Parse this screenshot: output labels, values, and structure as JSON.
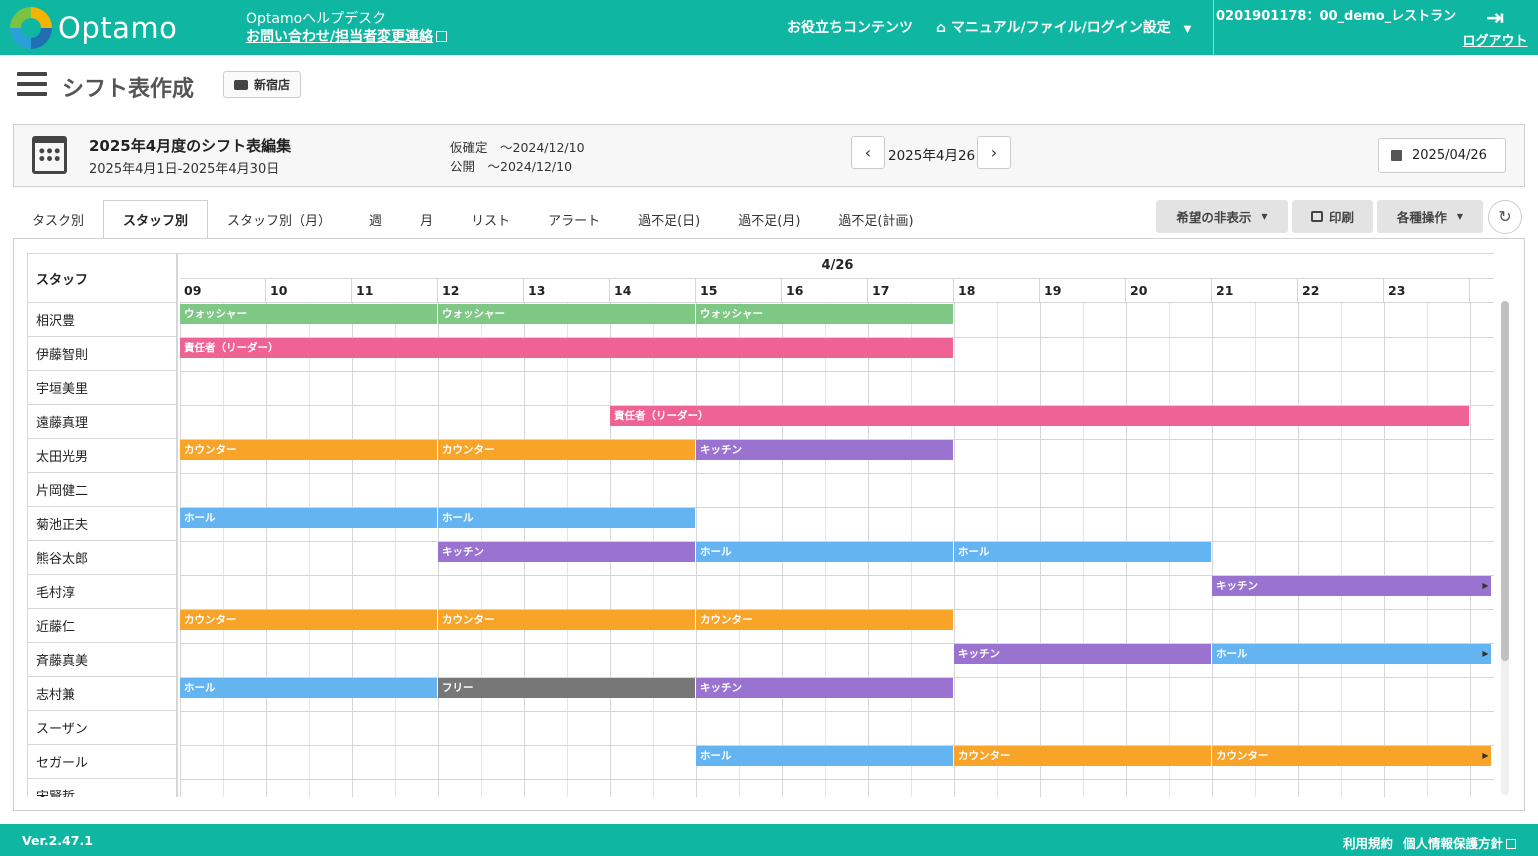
{
  "header": {
    "logo_text": "Optamo",
    "help_title": "Optamoヘルプデスク",
    "help_link": "お問い合わせ/担当者変更連絡",
    "useful": "お役立ちコンテンツ",
    "manual": "マニュアル/ファイル/ログイン設定",
    "account": "0201901178：00_demo_レストラン",
    "logout": "ログアウト"
  },
  "page": {
    "title": "シフト表作成",
    "store_button": "新宿店"
  },
  "info": {
    "title": "2025年4月度のシフト表編集",
    "range": "2025年4月1日-2025年4月30日",
    "tentative": "仮確定　～2024/12/10",
    "published": "公開　～2024/12/10",
    "current_date": "2025年4月26日",
    "date_input": "2025/04/26"
  },
  "tabs": [
    "タスク別",
    "スタッフ別",
    "スタッフ別（月）",
    "週",
    "月",
    "リスト",
    "アラート",
    "過不足(日)",
    "過不足(月)",
    "過不足(計画)"
  ],
  "active_tab": 1,
  "toolbar": {
    "hide_wishes": "希望の非表示",
    "print": "印刷",
    "operations": "各種操作"
  },
  "grid": {
    "staff_header": "スタッフ",
    "date_header": "4/26",
    "hours": [
      "09",
      "10",
      "11",
      "12",
      "13",
      "14",
      "15",
      "16",
      "17",
      "18",
      "19",
      "20",
      "21",
      "22",
      "23"
    ],
    "staff": [
      "相沢豊",
      "伊藤智則",
      "宇垣美里",
      "遠藤真理",
      "太田光男",
      "片岡健二",
      "菊池正夫",
      "熊谷太郎",
      "毛村淳",
      "近藤仁",
      "斉藤真美",
      "志村兼",
      "スーザン",
      "セガール",
      "宋賢哲"
    ]
  },
  "task_colors": {
    "ウォッシャー": "#7ec784",
    "責任者（リーダー）": "#ef6394",
    "カウンター": "#f7a428",
    "キッチン": "#9a72cf",
    "ホール": "#64b4f2",
    "フリー": "#777777"
  },
  "shifts": [
    {
      "row": 0,
      "start": 9,
      "end": 12,
      "task": "ウォッシャー"
    },
    {
      "row": 0,
      "start": 12,
      "end": 15,
      "task": "ウォッシャー"
    },
    {
      "row": 0,
      "start": 15,
      "end": 18,
      "task": "ウォッシャー"
    },
    {
      "row": 1,
      "start": 9,
      "end": 18,
      "task": "責任者（リーダー）"
    },
    {
      "row": 3,
      "start": 14,
      "end": 24,
      "task": "責任者（リーダー）"
    },
    {
      "row": 4,
      "start": 9,
      "end": 12,
      "task": "カウンター"
    },
    {
      "row": 4,
      "start": 12,
      "end": 15,
      "task": "カウンター"
    },
    {
      "row": 4,
      "start": 15,
      "end": 18,
      "task": "キッチン"
    },
    {
      "row": 6,
      "start": 9,
      "end": 12,
      "task": "ホール"
    },
    {
      "row": 6,
      "start": 12,
      "end": 15,
      "task": "ホール"
    },
    {
      "row": 7,
      "start": 12,
      "end": 15,
      "task": "キッチン"
    },
    {
      "row": 7,
      "start": 15,
      "end": 18,
      "task": "ホール"
    },
    {
      "row": 7,
      "start": 18,
      "end": 21,
      "task": "ホール"
    },
    {
      "row": 8,
      "start": 21,
      "end": 24.25,
      "task": "キッチン",
      "continues": true
    },
    {
      "row": 9,
      "start": 9,
      "end": 12,
      "task": "カウンター"
    },
    {
      "row": 9,
      "start": 12,
      "end": 15,
      "task": "カウンター"
    },
    {
      "row": 9,
      "start": 15,
      "end": 18,
      "task": "カウンター"
    },
    {
      "row": 10,
      "start": 18,
      "end": 21,
      "task": "キッチン"
    },
    {
      "row": 10,
      "start": 21,
      "end": 24.25,
      "task": "ホール",
      "continues": true
    },
    {
      "row": 11,
      "start": 9,
      "end": 12,
      "task": "ホール"
    },
    {
      "row": 11,
      "start": 12,
      "end": 15,
      "task": "フリー"
    },
    {
      "row": 11,
      "start": 15,
      "end": 18,
      "task": "キッチン"
    },
    {
      "row": 13,
      "start": 15,
      "end": 18,
      "task": "ホール"
    },
    {
      "row": 13,
      "start": 18,
      "end": 21,
      "task": "カウンター"
    },
    {
      "row": 13,
      "start": 21,
      "end": 24.25,
      "task": "カウンター",
      "continues": true
    }
  ],
  "footer": {
    "version": "Ver.2.47.1",
    "terms": "利用規約",
    "privacy": "個人情報保護方針"
  }
}
